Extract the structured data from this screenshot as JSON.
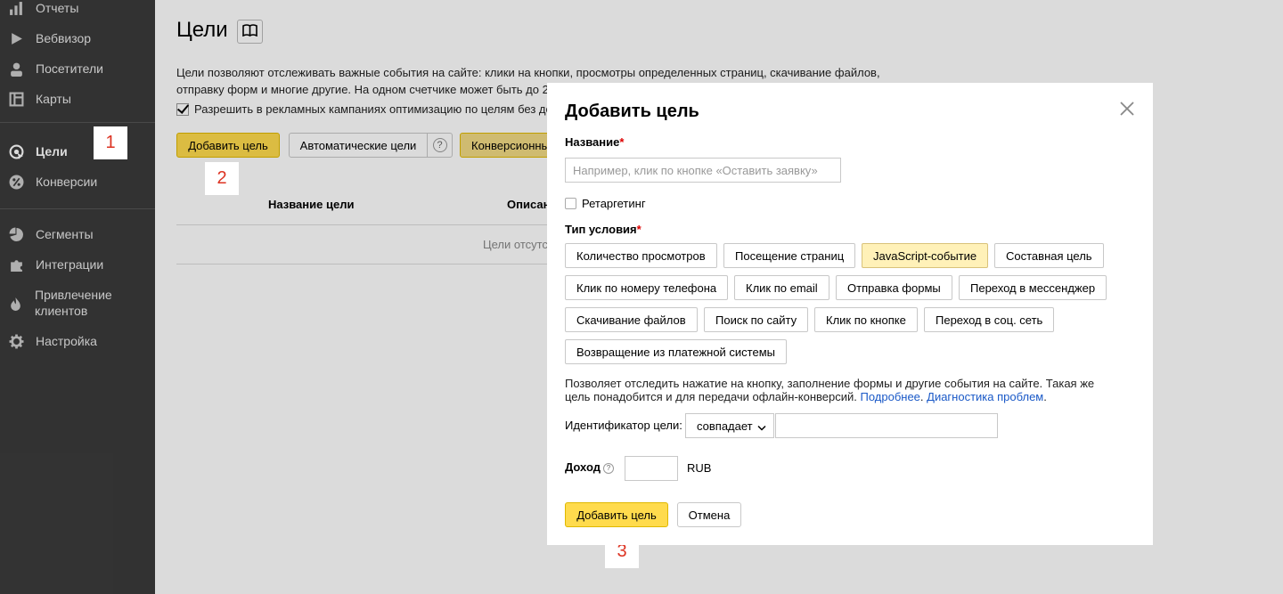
{
  "sidebar": {
    "items": [
      {
        "label": "Отчеты",
        "icon": "bar-chart-icon"
      },
      {
        "label": "Вебвизор",
        "icon": "play-icon"
      },
      {
        "label": "Посетители",
        "icon": "person-icon"
      },
      {
        "label": "Карты",
        "icon": "map-icon"
      },
      {
        "label": "Цели",
        "icon": "target-icon"
      },
      {
        "label": "Конверсии",
        "icon": "percent-icon"
      },
      {
        "label": "Сегменты",
        "icon": "pie-icon"
      },
      {
        "label": "Интеграции",
        "icon": "puzzle-icon"
      },
      {
        "label": "Привлечение клиентов",
        "icon": "fire-icon"
      },
      {
        "label": "Настройка",
        "icon": "gear-icon"
      }
    ]
  },
  "page": {
    "title": "Цели",
    "description": "Цели позволяют отслеживать важные события на сайте: клики на кнопки, просмотры определенных страниц, скачивание файлов, отправку форм и многие другие. На одном счетчике может быть до 2",
    "checkbox_label": "Разрешить в рекламных кампаниях оптимизацию по целям без до",
    "add_goal_button": "Добавить цель",
    "auto_goals_button": "Автоматические цели",
    "help_symbol": "?",
    "conversion_button": "Конверсионны",
    "col_name": "Название цели",
    "col_desc": "Описан",
    "empty": "Цели отсутс"
  },
  "markers": [
    "1",
    "2",
    "3"
  ],
  "modal": {
    "title": "Добавить цель",
    "name_label": "Название",
    "required_mark": "*",
    "name_placeholder": "Например, клик по кнопке «Оставить заявку»",
    "retargeting_label": "Ретаргетинг",
    "condition_label": "Тип условия",
    "condition_types": [
      "Количество просмотров",
      "Посещение страниц",
      "JavaScript-событие",
      "Составная цель",
      "Клик по номеру телефона",
      "Клик по email",
      "Отправка формы",
      "Переход в мессенджер",
      "Скачивание файлов",
      "Поиск по сайту",
      "Клик по кнопке",
      "Переход в соц. сеть",
      "Возвращение из платежной системы"
    ],
    "selected_condition": "JavaScript-событие",
    "hint_text": "Позволяет отследить нажатие на кнопку, заполнение формы и другие события на сайте. Такая же цель понадобится и для передачи офлайн-конверсий. ",
    "hint_link_more": "Подробнее",
    "hint_link_sep": ". ",
    "hint_link_diag": "Диагностика проблем",
    "hint_end": ".",
    "id_label": "Идентификатор цели:",
    "match_option": "совпадает",
    "id_value": "",
    "income_label": "Доход",
    "income_value": "",
    "currency": "RUB",
    "submit_button": "Добавить цель",
    "cancel_button": "Отмена"
  },
  "colors": {
    "sidebar_bg": "#3b3b3b",
    "yellow": "#ffdb4d",
    "selected_type": "#fff1b8",
    "link": "#1a59c7",
    "marker_text": "#dd3322"
  }
}
